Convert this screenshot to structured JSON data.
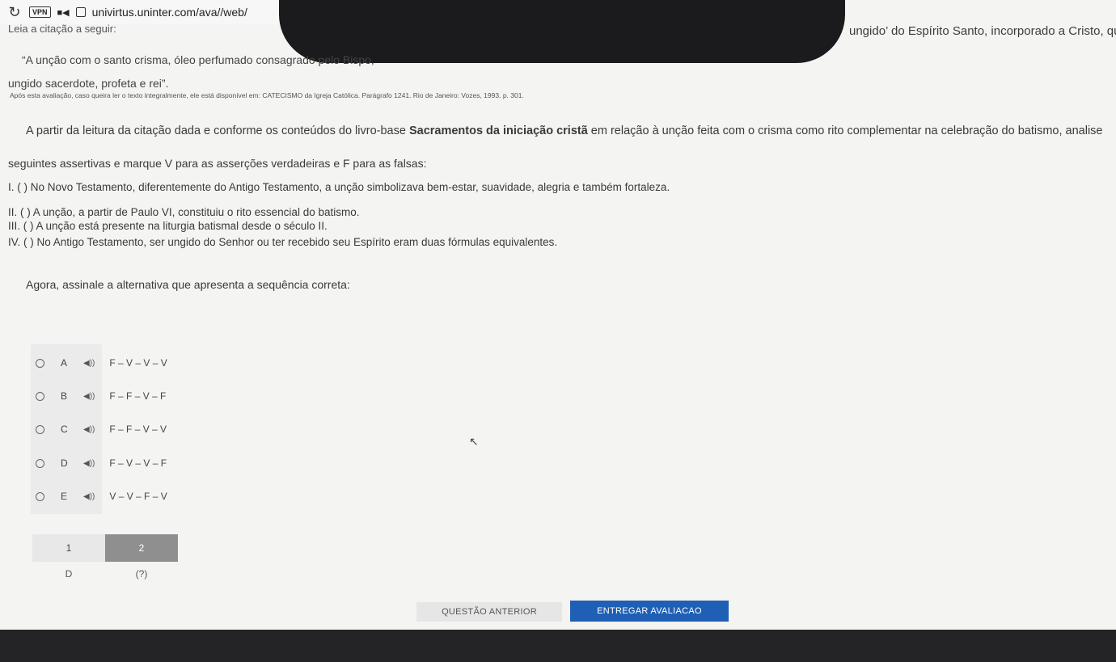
{
  "browser": {
    "vpn_label": "VPN",
    "url": "univirtus.uninter.com/ava//web/"
  },
  "question": {
    "intro": "Leia a citação a seguir:",
    "fragment_right": "ungido’ do Espírito Santo, incorporado a Cristo, que",
    "quote_line1": "“A unção com o santo crisma, óleo perfumado consagrado pelo Bispo,",
    "quote_line2": "ungido sacerdote, profeta e rei”.",
    "reference": "Após esta avaliação, caso queira ler o texto integralmente, ele está disponível em: CATECISMO da Igreja Católica. Parágrafo 1241. Rio de Janeiro: Vozes, 1993. p. 301.",
    "prompt_pre": "A partir da leitura da citação dada e conforme os conteúdos do livro-base ",
    "prompt_bold": "Sacramentos da iniciação cristã",
    "prompt_post": " em relação à unção feita com o crisma como rito complementar na celebração do batismo, analise",
    "prompt_line2": "seguintes assertivas e marque V para as asserções verdadeiras e F para as falsas:",
    "items": [
      "I. ( ) No Novo Testamento, diferentemente do Antigo Testamento, a unção simbolizava bem-estar, suavidade, alegria e também fortaleza.",
      "II. (   ) A unção, a partir de Paulo VI, constituiu o rito essencial do batismo.",
      "III. (   ) A unção está presente na liturgia batismal desde o século II.",
      "IV. (  ) No Antigo Testamento, ser ungido do Senhor ou ter recebido seu Espírito eram duas fórmulas equivalentes."
    ],
    "instruction": "Agora, assinale a alternativa que apresenta a sequência correta:"
  },
  "options": [
    {
      "letter": "A",
      "text": "F – V – V – V"
    },
    {
      "letter": "B",
      "text": "F – F – V – F"
    },
    {
      "letter": "C",
      "text": "F – F – V – V"
    },
    {
      "letter": "D",
      "text": "F – V – V – F"
    },
    {
      "letter": "E",
      "text": "V – V – F – V"
    }
  ],
  "answers_table": {
    "headers": [
      "1",
      "2"
    ],
    "values": [
      "D",
      "(?)"
    ]
  },
  "buttons": {
    "previous": "QUESTÃO ANTERIOR",
    "submit": "ENTREGAR AVALIACAO"
  },
  "colors": {
    "accent": "#1f5fb6",
    "active_tab": "#8f8f8f"
  }
}
